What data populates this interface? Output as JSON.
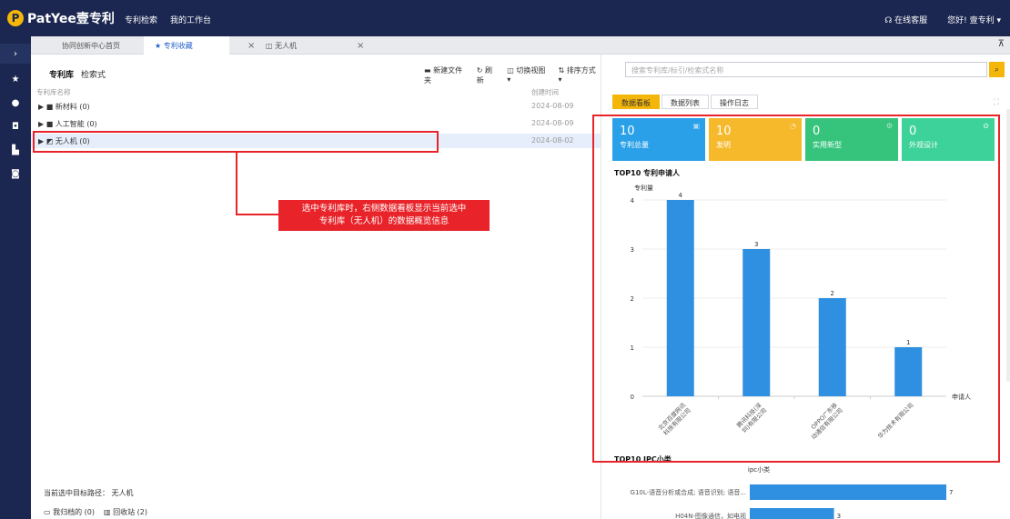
{
  "app": {
    "logo_mark": "P",
    "logo_text": "PatYee壹专利",
    "nav": [
      "专利检索",
      "我的工作台"
    ],
    "service": "在线客服",
    "user": "您好! 壹专利 ▾"
  },
  "side_icons": [
    "chevron-right-icon",
    "star-icon",
    "shield-icon",
    "chat-icon",
    "doc-icon",
    "user-icon"
  ],
  "tabs": {
    "t1": "协同创新中心首页",
    "t2": "★ 专利收藏",
    "t3": "◫ 无人机",
    "collapse": "⊼",
    "close": "×"
  },
  "left": {
    "subtabs": [
      "专利库",
      "检索式"
    ],
    "toolbar": {
      "new_folder": "新建文件夹",
      "refresh": "刷新",
      "switch_view": "切换视图 ▾",
      "sort": "排序方式 ▾"
    },
    "columns": {
      "name": "专利库名称",
      "date": "创建时间"
    },
    "rows": [
      {
        "name": "▶ ■ 新材料 (0)",
        "date": "2024-08-09"
      },
      {
        "name": "▶ ■ 人工智能 (0)",
        "date": "2024-08-09"
      },
      {
        "name": "▶ ◩ 无人机 (0)",
        "date": "2024-08-02"
      }
    ],
    "callout": {
      "line1": "选中专利库时，右侧数据看板显示当前选中",
      "line2": "专利库（无人机）的数据概览信息"
    },
    "path": "当前选中目标路径：  无人机",
    "bottom": {
      "mine": "我归档的 (0)",
      "recycle": "回收站 (2)"
    }
  },
  "right": {
    "search_placeholder": "搜索专利库/标引/检索式名称",
    "tabs": [
      "数据看板",
      "数据列表",
      "操作日志"
    ],
    "cards": [
      {
        "value": "10",
        "label": "专利总量",
        "color": "#2aa0e8"
      },
      {
        "value": "10",
        "label": "发明",
        "color": "#f6b92c"
      },
      {
        "value": "0",
        "label": "实用新型",
        "color": "#36c47c"
      },
      {
        "value": "0",
        "label": "外观设计",
        "color": "#3dd29a"
      }
    ],
    "top10_applicant_title": "TOP10 专利申请人",
    "top10_ipc_title": "TOP10 IPC小类"
  },
  "chart_data": [
    {
      "type": "bar",
      "title": "TOP10 专利申请人",
      "ylabel": "专利量",
      "xlabel": "申请人",
      "ylim": [
        0,
        4
      ],
      "yticks": [
        "0",
        "1",
        "2",
        "3",
        "4"
      ],
      "categories": [
        "北京百度网讯科技有限公司",
        "腾讯科技(深圳)有限公司",
        "OPPO广东移动通信有限公司",
        "华为技术有限公司"
      ],
      "values": [
        4,
        3,
        2,
        1
      ],
      "color": "#2f8fe0"
    },
    {
      "type": "bar",
      "title": "TOP10 IPC小类",
      "ylabel": "ipc小类",
      "categories": [
        "G10L-语音分析或合成; 语音识别; 语音...",
        "H04N-图像通信，如电视"
      ],
      "values": [
        7,
        3
      ],
      "color": "#2f8fe0"
    }
  ]
}
